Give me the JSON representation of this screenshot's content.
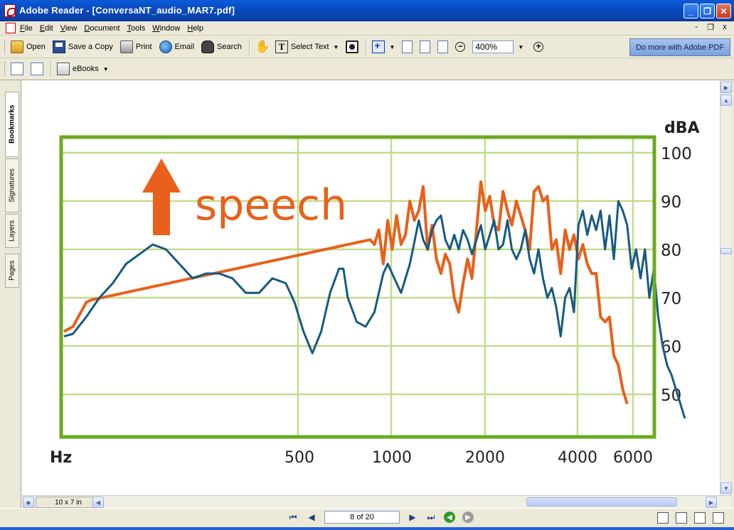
{
  "window": {
    "title": "Adobe Reader - [ConversaNT_audio_MAR7.pdf]",
    "minimize": "_",
    "restore": "❐",
    "close": "✕"
  },
  "menu": {
    "items": [
      "File",
      "Edit",
      "View",
      "Document",
      "Tools",
      "Window",
      "Help"
    ],
    "mdi_min": "-",
    "mdi_restore": "❐",
    "mdi_close": "x"
  },
  "toolbar": {
    "open": "Open",
    "save_copy": "Save a Copy",
    "print": "Print",
    "email": "Email",
    "search": "Search",
    "select_text": "Select Text",
    "zoom_value": "400%",
    "adobe_pdf": "Do more with Adobe PDF",
    "ebooks": "eBooks"
  },
  "sidebar": {
    "tabs": [
      "Bookmarks",
      "Signatures",
      "Layers",
      "Pages"
    ]
  },
  "document": {
    "page_size": "10 x 7 in",
    "page_indicator": "8 of 20"
  },
  "chart_data": {
    "type": "line",
    "y_label": "dBA",
    "x_label": "Hz",
    "annotation": "speech",
    "y_ticks": [
      100,
      90,
      80,
      70,
      60,
      50
    ],
    "x_ticks": [
      "500",
      "1000",
      "2000",
      "4000",
      "6000"
    ],
    "ylim": [
      40,
      100
    ],
    "grid": true,
    "colors": {
      "frame": "#6aac1e",
      "grid": "#c2dc8c",
      "blue": "#175a80",
      "orange": "#e8601a"
    },
    "series": [
      {
        "color": "orange",
        "points": [
          [
            0,
            63
          ],
          [
            0.02,
            64
          ],
          [
            0.05,
            69
          ],
          [
            0.06,
            69.5
          ],
          [
            0.69,
            82
          ],
          [
            0.7,
            81
          ],
          [
            0.71,
            84
          ],
          [
            0.72,
            77
          ],
          [
            0.73,
            86
          ],
          [
            0.74,
            80
          ],
          [
            0.75,
            87
          ],
          [
            0.76,
            81
          ],
          [
            0.77,
            83
          ],
          [
            0.78,
            90
          ],
          [
            0.79,
            86
          ],
          [
            0.8,
            88
          ],
          [
            0.81,
            93
          ],
          [
            0.82,
            80
          ],
          [
            0.83,
            85
          ],
          [
            0.84,
            78
          ],
          [
            0.85,
            75
          ],
          [
            0.86,
            79
          ],
          [
            0.87,
            77
          ],
          [
            0.88,
            70
          ],
          [
            0.89,
            67
          ],
          [
            0.9,
            73
          ],
          [
            0.91,
            78
          ],
          [
            0.92,
            74
          ],
          [
            0.93,
            84
          ],
          [
            0.94,
            94
          ],
          [
            0.95,
            88
          ],
          [
            0.96,
            91
          ],
          [
            0.97,
            85
          ],
          [
            0.98,
            84
          ],
          [
            0.99,
            92
          ],
          [
            1.0,
            88
          ],
          [
            1.01,
            85
          ],
          [
            1.02,
            90
          ],
          [
            1.03,
            87
          ],
          [
            1.04,
            84
          ],
          [
            1.05,
            80
          ],
          [
            1.06,
            92
          ],
          [
            1.07,
            93
          ],
          [
            1.08,
            90
          ],
          [
            1.09,
            91
          ],
          [
            1.1,
            80
          ],
          [
            1.11,
            82
          ],
          [
            1.12,
            75
          ],
          [
            1.13,
            84
          ],
          [
            1.14,
            80
          ],
          [
            1.15,
            83
          ],
          [
            1.16,
            78
          ],
          [
            1.17,
            81
          ],
          [
            1.18,
            77
          ],
          [
            1.19,
            75
          ],
          [
            1.2,
            75
          ],
          [
            1.21,
            66
          ],
          [
            1.22,
            65
          ],
          [
            1.23,
            66
          ],
          [
            1.24,
            58
          ],
          [
            1.25,
            56
          ],
          [
            1.26,
            51
          ],
          [
            1.27,
            48
          ]
        ]
      },
      {
        "color": "blue",
        "points": [
          [
            0,
            62
          ],
          [
            0.02,
            62.5
          ],
          [
            0.05,
            66
          ],
          [
            0.08,
            70
          ],
          [
            0.11,
            73
          ],
          [
            0.14,
            77
          ],
          [
            0.17,
            79
          ],
          [
            0.2,
            81
          ],
          [
            0.23,
            80
          ],
          [
            0.26,
            77
          ],
          [
            0.29,
            74
          ],
          [
            0.32,
            75
          ],
          [
            0.35,
            75
          ],
          [
            0.38,
            74
          ],
          [
            0.41,
            71
          ],
          [
            0.44,
            71
          ],
          [
            0.47,
            74
          ],
          [
            0.5,
            73
          ],
          [
            0.52,
            69
          ],
          [
            0.54,
            63
          ],
          [
            0.56,
            58.5
          ],
          [
            0.58,
            63
          ],
          [
            0.6,
            71
          ],
          [
            0.62,
            76
          ],
          [
            0.63,
            76
          ],
          [
            0.64,
            70
          ],
          [
            0.66,
            65
          ],
          [
            0.68,
            64
          ],
          [
            0.7,
            67
          ],
          [
            0.72,
            75
          ],
          [
            0.73,
            77
          ],
          [
            0.75,
            73
          ],
          [
            0.76,
            71
          ],
          [
            0.78,
            77
          ],
          [
            0.8,
            86
          ],
          [
            0.81,
            82
          ],
          [
            0.82,
            80
          ],
          [
            0.83,
            84
          ],
          [
            0.84,
            86
          ],
          [
            0.85,
            87
          ],
          [
            0.86,
            82
          ],
          [
            0.87,
            80
          ],
          [
            0.88,
            83
          ],
          [
            0.89,
            80
          ],
          [
            0.9,
            84
          ],
          [
            0.91,
            82
          ],
          [
            0.92,
            79
          ],
          [
            0.93,
            82
          ],
          [
            0.94,
            85
          ],
          [
            0.95,
            80
          ],
          [
            0.96,
            83
          ],
          [
            0.97,
            86
          ],
          [
            0.98,
            80
          ],
          [
            0.99,
            81
          ],
          [
            1.0,
            86
          ],
          [
            1.01,
            80
          ],
          [
            1.02,
            78
          ],
          [
            1.03,
            80
          ],
          [
            1.04,
            84
          ],
          [
            1.05,
            78
          ],
          [
            1.06,
            75
          ],
          [
            1.07,
            80
          ],
          [
            1.08,
            74
          ],
          [
            1.09,
            70
          ],
          [
            1.1,
            72
          ],
          [
            1.11,
            68
          ],
          [
            1.12,
            62
          ],
          [
            1.13,
            70
          ],
          [
            1.14,
            72
          ],
          [
            1.15,
            67
          ],
          [
            1.16,
            85
          ],
          [
            1.17,
            88
          ],
          [
            1.18,
            83
          ],
          [
            1.19,
            87
          ],
          [
            1.2,
            84
          ],
          [
            1.21,
            88
          ],
          [
            1.22,
            80
          ],
          [
            1.23,
            87
          ],
          [
            1.24,
            78
          ],
          [
            1.25,
            90
          ],
          [
            1.26,
            88
          ],
          [
            1.27,
            85
          ],
          [
            1.28,
            76
          ],
          [
            1.29,
            80
          ],
          [
            1.3,
            74
          ],
          [
            1.31,
            80
          ],
          [
            1.32,
            70
          ],
          [
            1.33,
            76
          ],
          [
            1.34,
            66
          ],
          [
            1.35,
            60
          ],
          [
            1.36,
            56
          ],
          [
            1.37,
            54
          ],
          [
            1.38,
            51
          ],
          [
            1.39,
            48
          ],
          [
            1.4,
            45
          ]
        ]
      }
    ]
  }
}
